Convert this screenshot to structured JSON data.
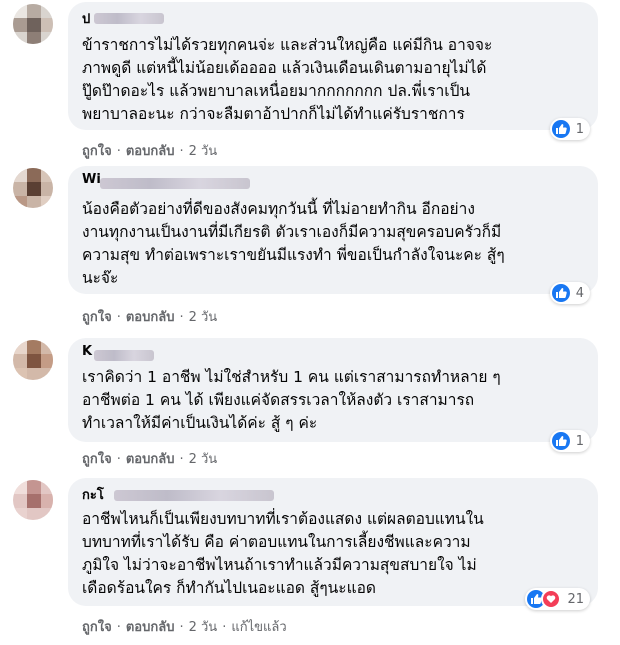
{
  "comments": [
    {
      "name": "ป",
      "lines": [
        "ข้าราชการไม่ได้รวยทุกคนจ่ะ และส่วนใหญ่คือ แค่มีกิน อาจจะ",
        "ภาพดูดี แต่หนี้ไม่น้อยเด้ออออ แล้วเงินเดือนเดินตามอายุไม่ได้",
        "ปู๊ดป๊าดอะไร แล้วพยาบาลเหนื่อยมากกกกกกก ปล.พี่เราเป็น",
        "พยาบาลอะนะ กว่าจะลืมตาอ้าปากก็ไม่ได้ทำแค่รับราชการ"
      ],
      "reaction_count": "1",
      "reaction_types": [
        "like-icon"
      ],
      "like": "ถูกใจ",
      "reply": "ตอบกลับ",
      "time": "2 วัน"
    },
    {
      "name": "Wi",
      "lines": [
        "น้องคือตัวอย่างที่ดีของสังคมทุกวันนี้ ที่ไม่อายทำกิน อีกอย่าง",
        "งานทุกงานเป็นงานที่มีเกียรติ ตัวเราเองก็มีความสุขครอบครัวก็มี",
        "ความสุข ทำต่อเพราะเราขยันมีแรงทำ พี่ขอเป็นกำลังใจนะคะ สู้ๆ",
        "นะจ๊ะ"
      ],
      "reaction_count": "4",
      "reaction_types": [
        "like-icon"
      ],
      "like": "ถูกใจ",
      "reply": "ตอบกลับ",
      "time": "2 วัน"
    },
    {
      "name": "K",
      "lines": [
        "เราคิดว่า 1 อาชีพ ไม่ใช่สำหรับ 1 คน แต่เราสามารถทำหลาย ๆ",
        "อาชีพต่อ 1 คน ได้ เพียงแค่จัดสรรเวลาให้ลงตัว เราสามารถ",
        "ทำเวลาให้มีค่าเป็นเงินได้ค่ะ สู้ ๆ ค่ะ"
      ],
      "reaction_count": "1",
      "reaction_types": [
        "like-icon"
      ],
      "like": "ถูกใจ",
      "reply": "ตอบกลับ",
      "time": "2 วัน"
    },
    {
      "name": "กะโ",
      "lines": [
        "อาชีพไหนก็เป็นเพียงบทบาทที่เราต้องแสดง แต่ผลตอบแทนใน",
        "บทบาทที่เราได้รับ คือ ค่าตอบแทนในการเลี้ยงชีพและความ",
        "ภูมิใจ ไม่ว่าจะอาชีพไหนถ้าเราทำแล้วมีความสุขสบายใจ ไม่",
        "เดือดร้อนใคร ก็ทำกันไปเนอะแอด สู้ๆนะแอด"
      ],
      "reaction_count": "21",
      "reaction_types": [
        "like-icon",
        "love-icon"
      ],
      "like": "ถูกใจ",
      "reply": "ตอบกลับ",
      "time": "2 วัน",
      "edited": "แก้ไขแล้ว"
    }
  ]
}
